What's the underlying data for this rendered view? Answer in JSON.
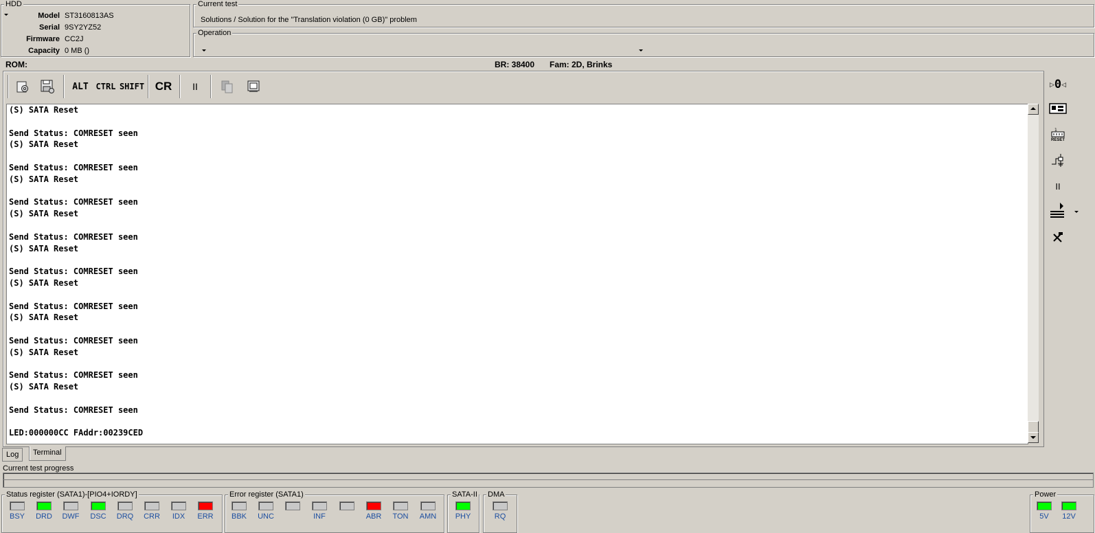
{
  "hdd": {
    "title": "HDD",
    "fields": [
      {
        "label": "Model",
        "value": "ST3160813AS"
      },
      {
        "label": "Serial",
        "value": "9SY2YZ52"
      },
      {
        "label": "Firmware",
        "value": "CC2J"
      },
      {
        "label": "Capacity",
        "value": "0 MB ()"
      }
    ]
  },
  "current_test": {
    "title": "Current test",
    "value": "Solutions / Solution for the \"Translation violation (0 GB)\"  problem"
  },
  "operation": {
    "title": "Operation",
    "value": ""
  },
  "status_bar": {
    "rom_label": "ROM:",
    "baud_rate": "BR: 38400",
    "family": "Fam: 2D, Brinks"
  },
  "toolbar": {
    "alt": "ALT",
    "ctrl": "CTRL",
    "shift": "SHIFT",
    "cr": "CR",
    "pause": "II"
  },
  "terminal": {
    "lines": [
      "(S) SATA Reset",
      "",
      "Send Status: COMRESET seen",
      "(S) SATA Reset",
      "",
      "Send Status: COMRESET seen",
      "(S) SATA Reset",
      "",
      "Send Status: COMRESET seen",
      "(S) SATA Reset",
      "",
      "Send Status: COMRESET seen",
      "(S) SATA Reset",
      "",
      "Send Status: COMRESET seen",
      "(S) SATA Reset",
      "",
      "Send Status: COMRESET seen",
      "(S) SATA Reset",
      "",
      "Send Status: COMRESET seen",
      "(S) SATA Reset",
      "",
      "Send Status: COMRESET seen",
      "(S) SATA Reset",
      "",
      "Send Status: COMRESET seen",
      "",
      "LED:000000CC FAddr:00239CED"
    ]
  },
  "tabs": [
    {
      "label": "Log",
      "active": false
    },
    {
      "label": "Terminal",
      "active": true
    }
  ],
  "progress": {
    "label": "Current test progress",
    "value": 0
  },
  "status_register": {
    "title": "Status register (SATA1)-[PIO4+IORDY]",
    "leds": [
      {
        "label": "BSY",
        "color": "#c8c8c8"
      },
      {
        "label": "DRD",
        "color": "#00ff00"
      },
      {
        "label": "DWF",
        "color": "#c8c8c8"
      },
      {
        "label": "DSC",
        "color": "#00ff00"
      },
      {
        "label": "DRQ",
        "color": "#c8c8c8"
      },
      {
        "label": "CRR",
        "color": "#c8c8c8"
      },
      {
        "label": "IDX",
        "color": "#c8c8c8"
      },
      {
        "label": "ERR",
        "color": "#ff0000"
      }
    ]
  },
  "error_register": {
    "title": "Error register (SATA1)",
    "leds": [
      {
        "label": "BBK",
        "color": "#c8c8c8"
      },
      {
        "label": "UNC",
        "color": "#c8c8c8"
      },
      {
        "label": "",
        "color": "#c8c8c8"
      },
      {
        "label": "INF",
        "color": "#c8c8c8"
      },
      {
        "label": "",
        "color": "#c8c8c8"
      },
      {
        "label": "ABR",
        "color": "#ff0000"
      },
      {
        "label": "TON",
        "color": "#c8c8c8"
      },
      {
        "label": "AMN",
        "color": "#c8c8c8"
      }
    ]
  },
  "sata2": {
    "title": "SATA-II",
    "leds": [
      {
        "label": "PHY",
        "color": "#00ff00"
      }
    ]
  },
  "dma": {
    "title": "DMA",
    "leds": [
      {
        "label": "RQ",
        "color": "#c8c8c8"
      }
    ]
  },
  "power": {
    "title": "Power",
    "leds": [
      {
        "label": "5V",
        "color": "#00ff00"
      },
      {
        "label": "12V",
        "color": "#00ff00"
      }
    ]
  },
  "right_toolbar": {
    "power_label": "0",
    "reset_label": "RESET"
  }
}
